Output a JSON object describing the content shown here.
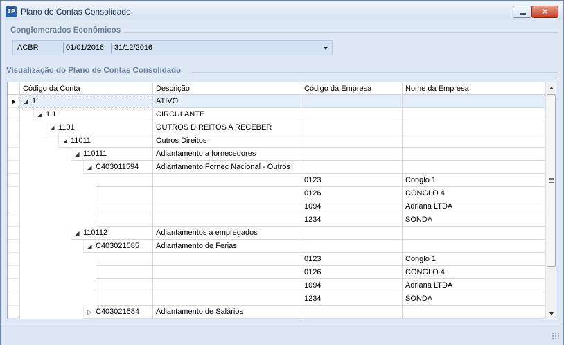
{
  "window": {
    "title": "Plano de Contas Consolidado",
    "icon": "SP"
  },
  "conglomerados": {
    "legend": "Conglomerados Econômicos",
    "selected": {
      "code": "ACBR",
      "start_date": "01/01/2016",
      "end_date": "31/12/2016"
    }
  },
  "plano": {
    "legend": "Visualização do Plano de Contas Consolidado",
    "columns": [
      "Código da Conta",
      "Descrição",
      "Código da Empresa",
      "Nome da Empresa"
    ],
    "rows": [
      {
        "code": "1",
        "desc": "ATIVO",
        "emp_code": "",
        "emp_name": "",
        "level": 0,
        "toggle": "expanded",
        "selected": true
      },
      {
        "code": "1.1",
        "desc": "CIRCULANTE",
        "emp_code": "",
        "emp_name": "",
        "level": 1,
        "toggle": "expanded"
      },
      {
        "code": "1101",
        "desc": "OUTROS DIREITOS A RECEBER",
        "emp_code": "",
        "emp_name": "",
        "level": 2,
        "toggle": "expanded"
      },
      {
        "code": "11011",
        "desc": "Outros Direitos",
        "emp_code": "",
        "emp_name": "",
        "level": 3,
        "toggle": "expanded"
      },
      {
        "code": "110111",
        "desc": "Adiantamento a fornecedores",
        "emp_code": "",
        "emp_name": "",
        "level": 4,
        "toggle": "expanded"
      },
      {
        "code": "C403011594",
        "desc": "Adiantamento Fornec Nacional - Outros",
        "emp_code": "",
        "emp_name": "",
        "level": 5,
        "toggle": "expanded"
      },
      {
        "code": "",
        "desc": "",
        "emp_code": "0123",
        "emp_name": "Conglo 1",
        "level": 6,
        "toggle": "none"
      },
      {
        "code": "",
        "desc": "",
        "emp_code": "0126",
        "emp_name": "CONGLO 4",
        "level": 6,
        "toggle": "none"
      },
      {
        "code": "",
        "desc": "",
        "emp_code": "1094",
        "emp_name": "Adriana LTDA",
        "level": 6,
        "toggle": "none"
      },
      {
        "code": "",
        "desc": "",
        "emp_code": "1234",
        "emp_name": "SONDA",
        "level": 6,
        "toggle": "none"
      },
      {
        "code": "110112",
        "desc": "Adiantamentos a empregados",
        "emp_code": "",
        "emp_name": "",
        "level": 4,
        "toggle": "expanded"
      },
      {
        "code": "C403021585",
        "desc": "Adiantamento de Ferias",
        "emp_code": "",
        "emp_name": "",
        "level": 5,
        "toggle": "expanded"
      },
      {
        "code": "",
        "desc": "",
        "emp_code": "0123",
        "emp_name": "Conglo 1",
        "level": 6,
        "toggle": "none"
      },
      {
        "code": "",
        "desc": "",
        "emp_code": "0126",
        "emp_name": "CONGLO 4",
        "level": 6,
        "toggle": "none"
      },
      {
        "code": "",
        "desc": "",
        "emp_code": "1094",
        "emp_name": "Adriana LTDA",
        "level": 6,
        "toggle": "none"
      },
      {
        "code": "",
        "desc": "",
        "emp_code": "1234",
        "emp_name": "SONDA",
        "level": 6,
        "toggle": "none"
      },
      {
        "code": "C403021584",
        "desc": "Adiantamento de Salários",
        "emp_code": "",
        "emp_name": "",
        "level": 5,
        "toggle": "collapsed"
      }
    ]
  }
}
